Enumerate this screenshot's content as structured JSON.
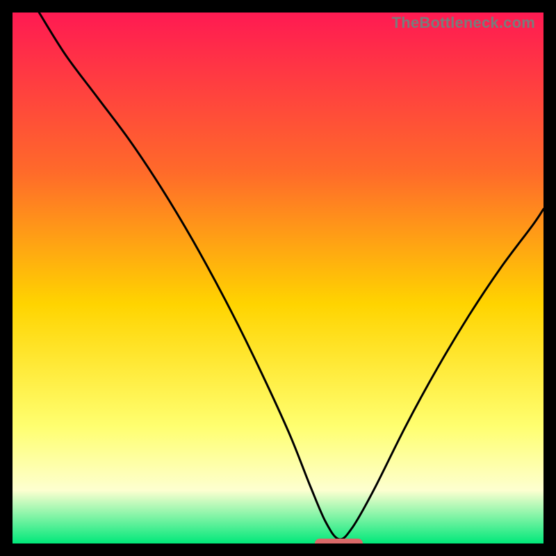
{
  "watermark": {
    "text": "TheBottleneck.com"
  },
  "colors": {
    "frame": "#000000",
    "gradient_top": "#ff1a52",
    "gradient_mid1": "#ff6a2a",
    "gradient_mid2": "#ffd400",
    "gradient_mid3": "#ffff70",
    "gradient_mid4": "#fdffd0",
    "gradient_bottom": "#00e87a",
    "curve": "#000000",
    "marker": "#d96a6a"
  },
  "chart_data": {
    "type": "line",
    "title": "",
    "xlabel": "",
    "ylabel": "",
    "xlim": [
      0,
      100
    ],
    "ylim": [
      0,
      100
    ],
    "marker": {
      "x_start": 57,
      "x_end": 66,
      "y": 0
    },
    "series": [
      {
        "name": "bottleneck-curve",
        "x": [
          5,
          10,
          16,
          22,
          28,
          34,
          40,
          46,
          52,
          56,
          59,
          61.5,
          64,
          68,
          74,
          80,
          86,
          92,
          98,
          100
        ],
        "values": [
          100,
          92,
          84,
          76,
          67,
          57,
          46,
          34,
          21,
          11,
          4,
          0.8,
          3,
          10,
          22,
          33,
          43,
          52,
          60,
          63
        ]
      }
    ],
    "gradient_stops": [
      {
        "pos": 0.0,
        "color": "#ff1a52"
      },
      {
        "pos": 0.3,
        "color": "#ff6a2a"
      },
      {
        "pos": 0.55,
        "color": "#ffd400"
      },
      {
        "pos": 0.78,
        "color": "#ffff70"
      },
      {
        "pos": 0.9,
        "color": "#fdffd0"
      },
      {
        "pos": 1.0,
        "color": "#00e87a"
      }
    ]
  }
}
